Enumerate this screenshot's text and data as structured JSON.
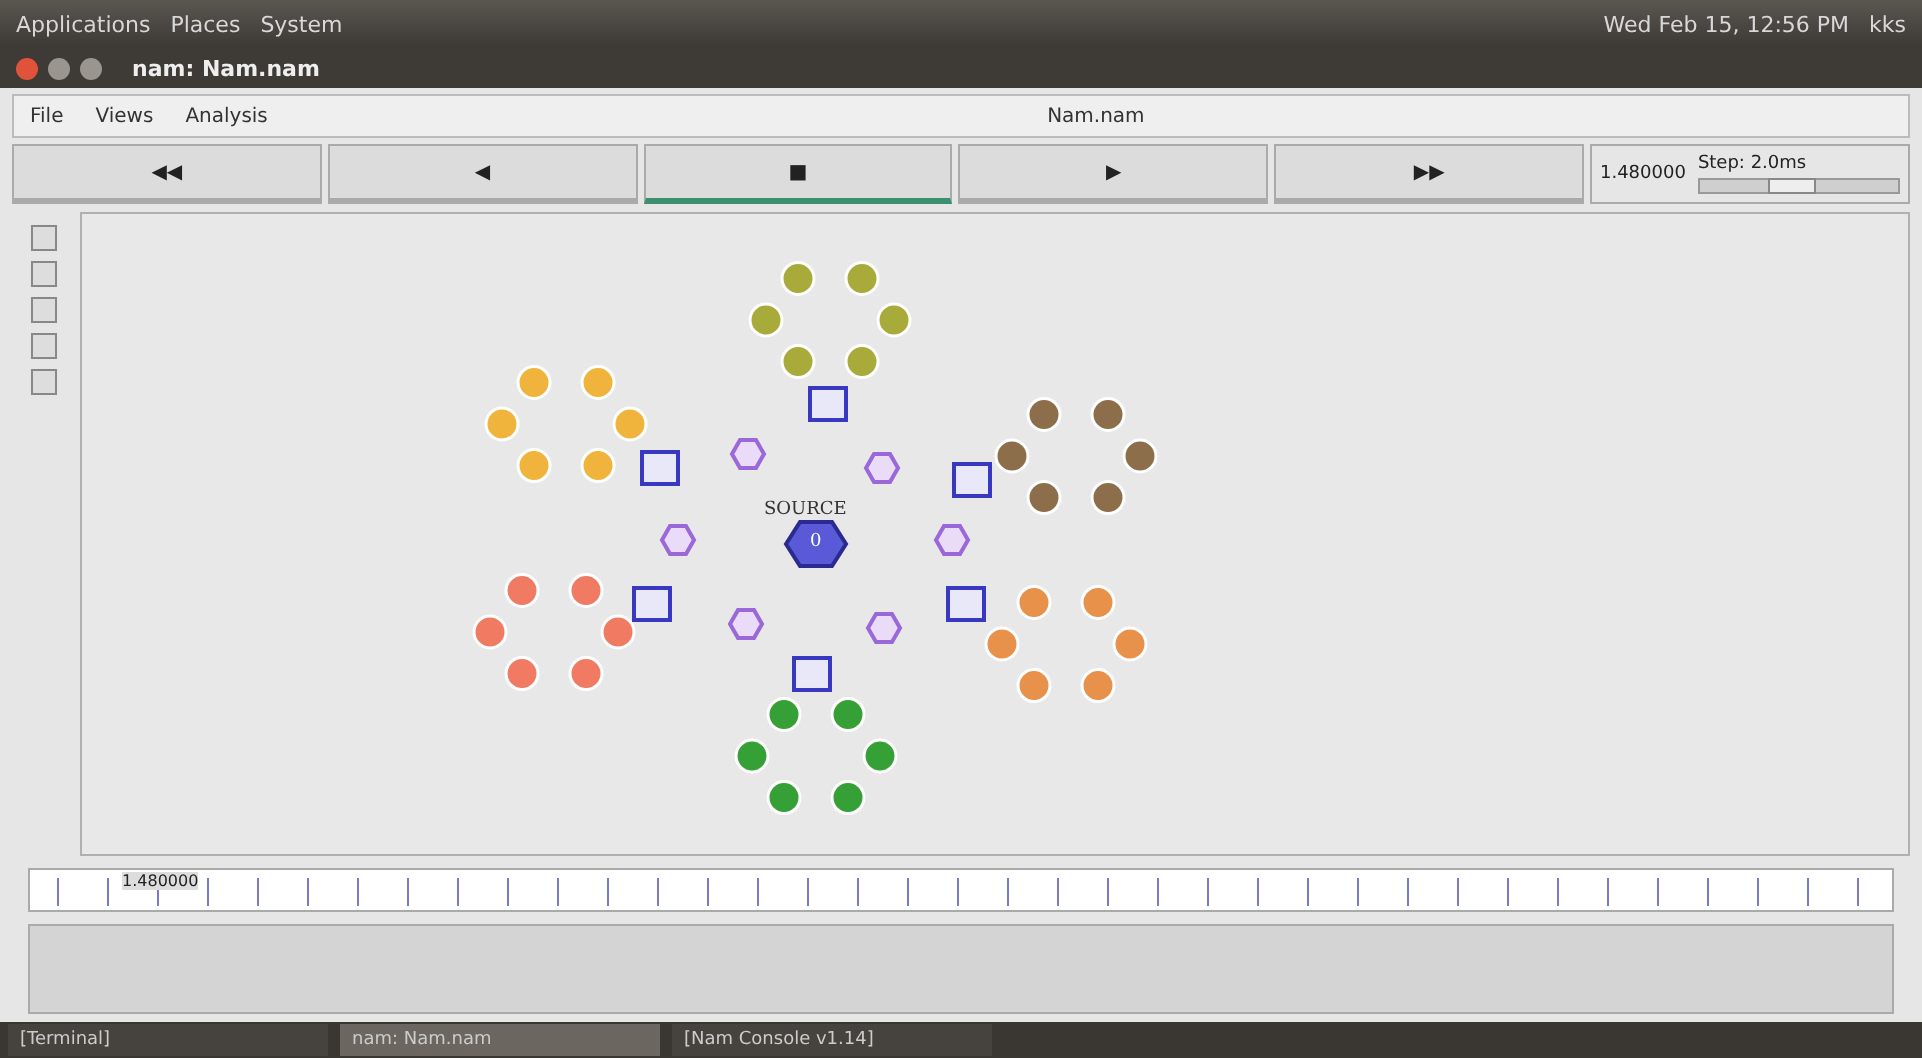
{
  "top_panel": {
    "menus": [
      "Applications",
      "Places",
      "System"
    ],
    "clock": "Wed Feb 15, 12:56 PM",
    "user": "kks"
  },
  "window": {
    "title": "nam: Nam.nam"
  },
  "menu_bar": {
    "items": [
      "File",
      "Views",
      "Analysis"
    ],
    "file_name": "Nam.nam"
  },
  "controls": [
    {
      "glyph": "◀◀",
      "selected": false
    },
    {
      "glyph": "◀",
      "selected": false
    },
    {
      "glyph": "■",
      "selected": true
    },
    {
      "glyph": "▶",
      "selected": false
    },
    {
      "glyph": "▶▶",
      "selected": false
    }
  ],
  "time": "1.480000",
  "timeline_marker": "1.480000",
  "step": {
    "label": "Step: 2.0ms",
    "level": 0.45
  },
  "network": {
    "source": {
      "label": "SOURCE",
      "id": "0"
    },
    "clusters": [
      {
        "color": "#a8ab3a"
      },
      {
        "color": "#f0b43c"
      },
      {
        "color": "#8c6e4a"
      },
      {
        "color": "#f07a62"
      },
      {
        "color": "#e8914a"
      },
      {
        "color": "#35a035"
      }
    ],
    "relays": [
      {
        "kind": "square"
      },
      {
        "kind": "square"
      },
      {
        "kind": "square"
      },
      {
        "kind": "square"
      },
      {
        "kind": "square"
      },
      {
        "kind": "square"
      },
      {
        "kind": "hexagon"
      },
      {
        "kind": "hexagon"
      },
      {
        "kind": "hexagon"
      },
      {
        "kind": "hexagon"
      },
      {
        "kind": "hexagon"
      },
      {
        "kind": "hexagon"
      }
    ]
  },
  "taskbar": [
    {
      "label": "[Terminal]",
      "selected": false
    },
    {
      "label": "nam: Nam.nam",
      "selected": true
    },
    {
      "label": "[Nam Console v1.14]",
      "selected": false
    }
  ]
}
